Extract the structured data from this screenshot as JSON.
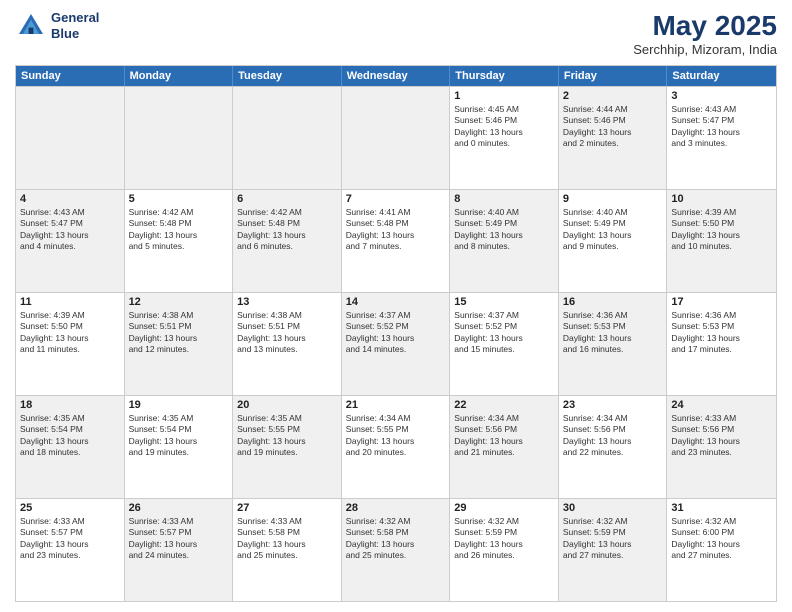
{
  "logo": {
    "line1": "General",
    "line2": "Blue"
  },
  "title": "May 2025",
  "subtitle": "Serchhip, Mizoram, India",
  "days": [
    "Sunday",
    "Monday",
    "Tuesday",
    "Wednesday",
    "Thursday",
    "Friday",
    "Saturday"
  ],
  "weeks": [
    [
      {
        "day": "",
        "info": "",
        "shaded": true
      },
      {
        "day": "",
        "info": "",
        "shaded": true
      },
      {
        "day": "",
        "info": "",
        "shaded": true
      },
      {
        "day": "",
        "info": "",
        "shaded": true
      },
      {
        "day": "1",
        "info": "Sunrise: 4:45 AM\nSunset: 5:46 PM\nDaylight: 13 hours\nand 0 minutes."
      },
      {
        "day": "2",
        "info": "Sunrise: 4:44 AM\nSunset: 5:46 PM\nDaylight: 13 hours\nand 2 minutes.",
        "shaded": true
      },
      {
        "day": "3",
        "info": "Sunrise: 4:43 AM\nSunset: 5:47 PM\nDaylight: 13 hours\nand 3 minutes."
      }
    ],
    [
      {
        "day": "4",
        "info": "Sunrise: 4:43 AM\nSunset: 5:47 PM\nDaylight: 13 hours\nand 4 minutes.",
        "shaded": true
      },
      {
        "day": "5",
        "info": "Sunrise: 4:42 AM\nSunset: 5:48 PM\nDaylight: 13 hours\nand 5 minutes."
      },
      {
        "day": "6",
        "info": "Sunrise: 4:42 AM\nSunset: 5:48 PM\nDaylight: 13 hours\nand 6 minutes.",
        "shaded": true
      },
      {
        "day": "7",
        "info": "Sunrise: 4:41 AM\nSunset: 5:48 PM\nDaylight: 13 hours\nand 7 minutes."
      },
      {
        "day": "8",
        "info": "Sunrise: 4:40 AM\nSunset: 5:49 PM\nDaylight: 13 hours\nand 8 minutes.",
        "shaded": true
      },
      {
        "day": "9",
        "info": "Sunrise: 4:40 AM\nSunset: 5:49 PM\nDaylight: 13 hours\nand 9 minutes."
      },
      {
        "day": "10",
        "info": "Sunrise: 4:39 AM\nSunset: 5:50 PM\nDaylight: 13 hours\nand 10 minutes.",
        "shaded": true
      }
    ],
    [
      {
        "day": "11",
        "info": "Sunrise: 4:39 AM\nSunset: 5:50 PM\nDaylight: 13 hours\nand 11 minutes."
      },
      {
        "day": "12",
        "info": "Sunrise: 4:38 AM\nSunset: 5:51 PM\nDaylight: 13 hours\nand 12 minutes.",
        "shaded": true
      },
      {
        "day": "13",
        "info": "Sunrise: 4:38 AM\nSunset: 5:51 PM\nDaylight: 13 hours\nand 13 minutes."
      },
      {
        "day": "14",
        "info": "Sunrise: 4:37 AM\nSunset: 5:52 PM\nDaylight: 13 hours\nand 14 minutes.",
        "shaded": true
      },
      {
        "day": "15",
        "info": "Sunrise: 4:37 AM\nSunset: 5:52 PM\nDaylight: 13 hours\nand 15 minutes."
      },
      {
        "day": "16",
        "info": "Sunrise: 4:36 AM\nSunset: 5:53 PM\nDaylight: 13 hours\nand 16 minutes.",
        "shaded": true
      },
      {
        "day": "17",
        "info": "Sunrise: 4:36 AM\nSunset: 5:53 PM\nDaylight: 13 hours\nand 17 minutes."
      }
    ],
    [
      {
        "day": "18",
        "info": "Sunrise: 4:35 AM\nSunset: 5:54 PM\nDaylight: 13 hours\nand 18 minutes.",
        "shaded": true
      },
      {
        "day": "19",
        "info": "Sunrise: 4:35 AM\nSunset: 5:54 PM\nDaylight: 13 hours\nand 19 minutes."
      },
      {
        "day": "20",
        "info": "Sunrise: 4:35 AM\nSunset: 5:55 PM\nDaylight: 13 hours\nand 19 minutes.",
        "shaded": true
      },
      {
        "day": "21",
        "info": "Sunrise: 4:34 AM\nSunset: 5:55 PM\nDaylight: 13 hours\nand 20 minutes."
      },
      {
        "day": "22",
        "info": "Sunrise: 4:34 AM\nSunset: 5:56 PM\nDaylight: 13 hours\nand 21 minutes.",
        "shaded": true
      },
      {
        "day": "23",
        "info": "Sunrise: 4:34 AM\nSunset: 5:56 PM\nDaylight: 13 hours\nand 22 minutes."
      },
      {
        "day": "24",
        "info": "Sunrise: 4:33 AM\nSunset: 5:56 PM\nDaylight: 13 hours\nand 23 minutes.",
        "shaded": true
      }
    ],
    [
      {
        "day": "25",
        "info": "Sunrise: 4:33 AM\nSunset: 5:57 PM\nDaylight: 13 hours\nand 23 minutes."
      },
      {
        "day": "26",
        "info": "Sunrise: 4:33 AM\nSunset: 5:57 PM\nDaylight: 13 hours\nand 24 minutes.",
        "shaded": true
      },
      {
        "day": "27",
        "info": "Sunrise: 4:33 AM\nSunset: 5:58 PM\nDaylight: 13 hours\nand 25 minutes."
      },
      {
        "day": "28",
        "info": "Sunrise: 4:32 AM\nSunset: 5:58 PM\nDaylight: 13 hours\nand 25 minutes.",
        "shaded": true
      },
      {
        "day": "29",
        "info": "Sunrise: 4:32 AM\nSunset: 5:59 PM\nDaylight: 13 hours\nand 26 minutes."
      },
      {
        "day": "30",
        "info": "Sunrise: 4:32 AM\nSunset: 5:59 PM\nDaylight: 13 hours\nand 27 minutes.",
        "shaded": true
      },
      {
        "day": "31",
        "info": "Sunrise: 4:32 AM\nSunset: 6:00 PM\nDaylight: 13 hours\nand 27 minutes."
      }
    ]
  ]
}
